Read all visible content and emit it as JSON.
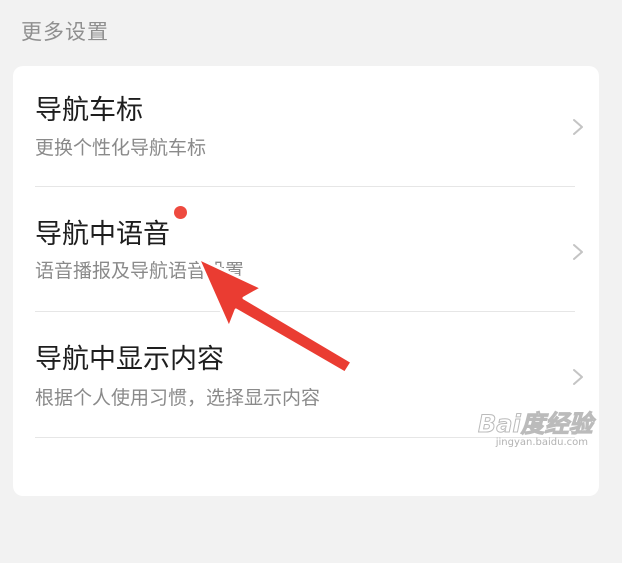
{
  "section": {
    "header": "更多设置"
  },
  "settings": {
    "items": [
      {
        "title": "导航车标",
        "subtitle": "更换个性化导航车标",
        "chevron_icon": "chevron-right-icon",
        "badge": false
      },
      {
        "title": "导航中语音",
        "subtitle": "语音播报及导航语音设置",
        "chevron_icon": "chevron-right-icon",
        "badge": true,
        "badge_color": "#ee4a3f"
      },
      {
        "title": "导航中显示内容",
        "subtitle": "根据个人使用习惯，选择显示内容",
        "chevron_icon": "chevron-right-icon",
        "badge": false
      },
      {
        "title": "",
        "subtitle": ""
      }
    ]
  },
  "overlay": {
    "arrow_color": "#ea3c32",
    "arrow_icon": "annotation-arrow-icon"
  },
  "watermark": {
    "text": "Bai度经验",
    "sub": "jingyan.baidu.com"
  },
  "colors": {
    "background": "#f2f2f2",
    "card": "#ffffff",
    "title": "#1e1e1e",
    "subtitle": "#8a8a8a",
    "divider": "#e6e6e6"
  }
}
